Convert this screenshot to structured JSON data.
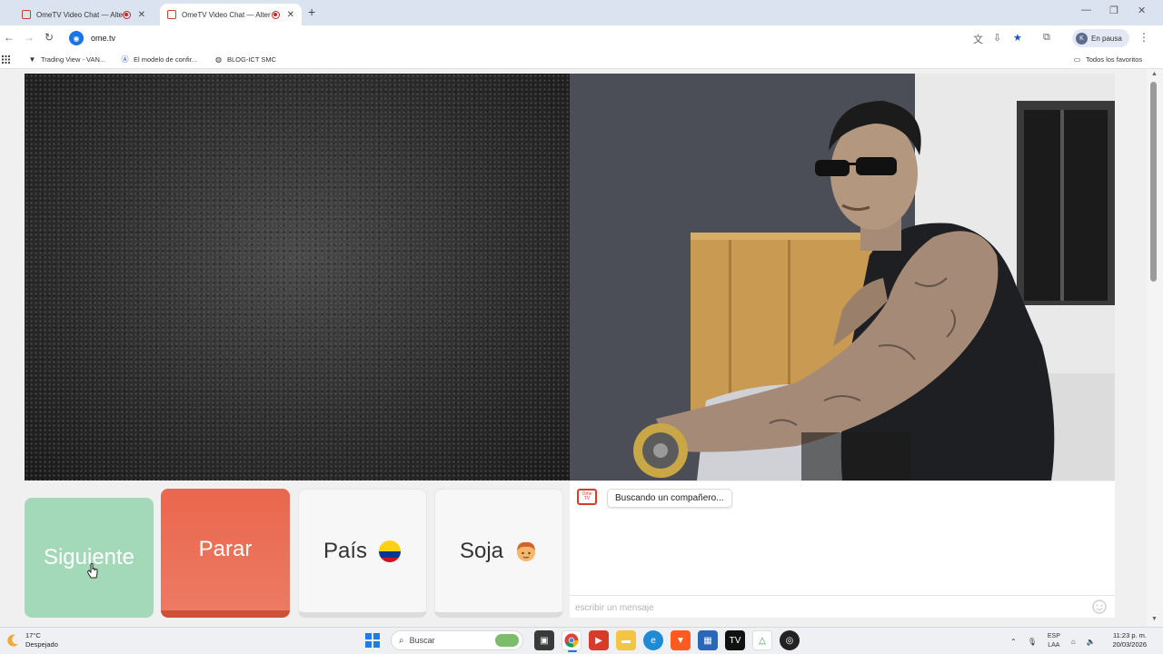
{
  "browser": {
    "tabs": [
      {
        "title": "OmeTV Video Chat — Alter",
        "active": false
      },
      {
        "title": "OmeTV Video Chat — Alter",
        "active": true
      }
    ],
    "url": "ome.tv",
    "profile_initial": "K",
    "profile_label": "En pausa",
    "bookmarks": [
      {
        "label": "Trading View - VAN...",
        "icon": "tradingview-icon"
      },
      {
        "label": "El modelo de confir...",
        "icon": "bookmark-a-icon"
      },
      {
        "label": "BLOG-ICT SMC",
        "icon": "globe-icon"
      }
    ],
    "all_favorites": "Todos los favoritos"
  },
  "app": {
    "buttons": {
      "next": "Siguiente",
      "stop": "Parar",
      "country": "País",
      "gender": "Soja"
    },
    "chat": {
      "logo_text": "Ome TV",
      "status_message": "Buscando un compañero...",
      "input_placeholder": "escribir un mensaje"
    },
    "colors": {
      "next_button": "#a3d9b8",
      "stop_button": "#e9674d"
    }
  },
  "taskbar": {
    "weather_temp": "17°C",
    "weather_desc": "Despejado",
    "search_placeholder": "Buscar",
    "lang_line1": "ESP",
    "lang_line2": "LAA",
    "time": "11:23 p. m.",
    "date": "20/03/2026"
  }
}
